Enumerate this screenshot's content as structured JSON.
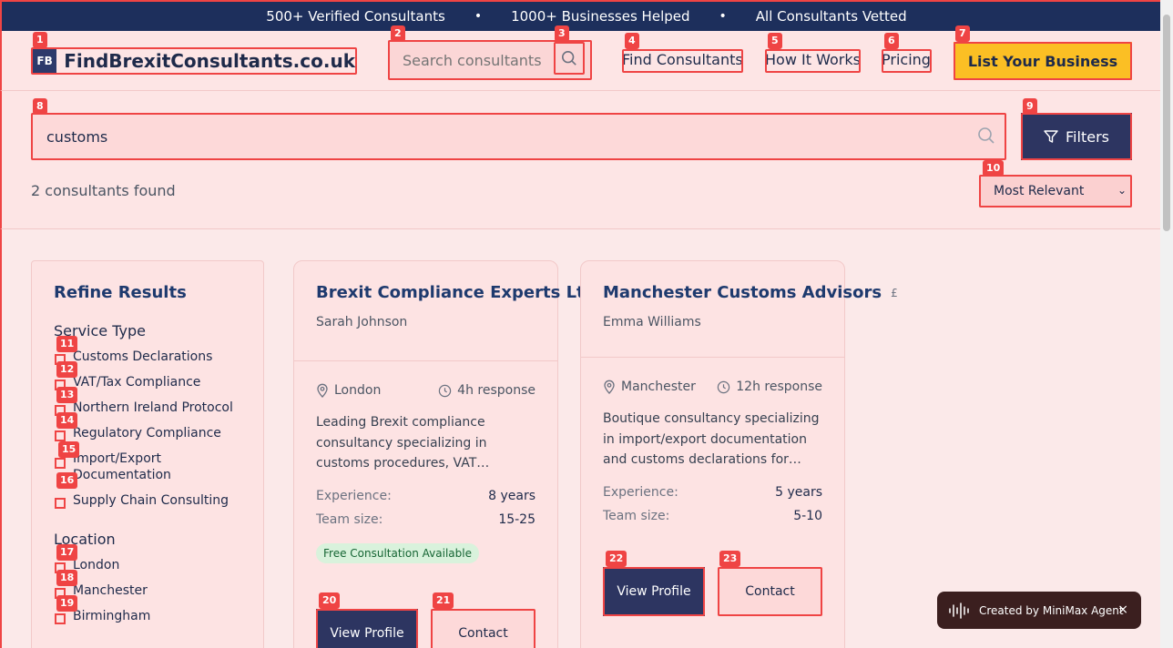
{
  "topbar": {
    "items": [
      "500+ Verified Consultants",
      "1000+ Businesses Helped",
      "All Consultants Vetted"
    ],
    "separator": "•"
  },
  "header": {
    "logo_mark": "FB",
    "logo_text": "FindBrexitConsultants.co.uk",
    "search_placeholder": "Search consultants",
    "nav": [
      "Find Consultants",
      "How It Works",
      "Pricing"
    ],
    "cta": "List Your Business"
  },
  "search": {
    "value": "customs",
    "filters_label": "Filters",
    "results_count": "2 consultants found",
    "sort_selected": "Most Relevant"
  },
  "sidebar": {
    "title": "Refine Results",
    "service_heading": "Service Type",
    "services": [
      "Customs Declarations",
      "VAT/Tax Compliance",
      "Northern Ireland Protocol",
      "Regulatory Compliance",
      "Import/Export Documentation",
      "Supply Chain Consulting"
    ],
    "location_heading": "Location",
    "locations": [
      "London",
      "Manchester",
      "Birmingham"
    ]
  },
  "cards": [
    {
      "title": "Brexit Compliance Experts Lt",
      "contact": "Sarah Johnson",
      "location": "London",
      "response": "4h response",
      "description": "Leading Brexit compliance consultancy specializing in customs procedures, VAT…",
      "experience_label": "Experience:",
      "experience": "8 years",
      "team_label": "Team size:",
      "team": "15-25",
      "badge": "Free Consultation Available",
      "view": "View Profile",
      "contact_btn": "Contact"
    },
    {
      "title": "Manchester Customs Advisors",
      "title_suffix": "£",
      "contact": "Emma Williams",
      "location": "Manchester",
      "response": "12h response",
      "description": "Boutique consultancy specializing in import/export documentation and customs declarations for…",
      "experience_label": "Experience:",
      "experience": "5 years",
      "team_label": "Team size:",
      "team": "5-10",
      "view": "View Profile",
      "contact_btn": "Contact"
    }
  ],
  "toast": {
    "label": "Created by MiniMax Agent",
    "close": "×"
  },
  "badges": [
    "1",
    "2",
    "3",
    "4",
    "5",
    "6",
    "7",
    "8",
    "9",
    "10",
    "11",
    "12",
    "13",
    "14",
    "15",
    "16",
    "17",
    "18",
    "19",
    "20",
    "21",
    "22",
    "23"
  ],
  "icons": {
    "search": "search-icon",
    "filter": "filter-icon",
    "pin": "map-pin-icon",
    "clock": "clock-icon",
    "verified": "check-circle-icon",
    "wave": "waveform-icon",
    "close": "close-icon"
  },
  "colors": {
    "navy": "#1d2f5c",
    "accent": "#fbbf24",
    "annotation": "#ef4444",
    "verified": "#22c55e"
  }
}
